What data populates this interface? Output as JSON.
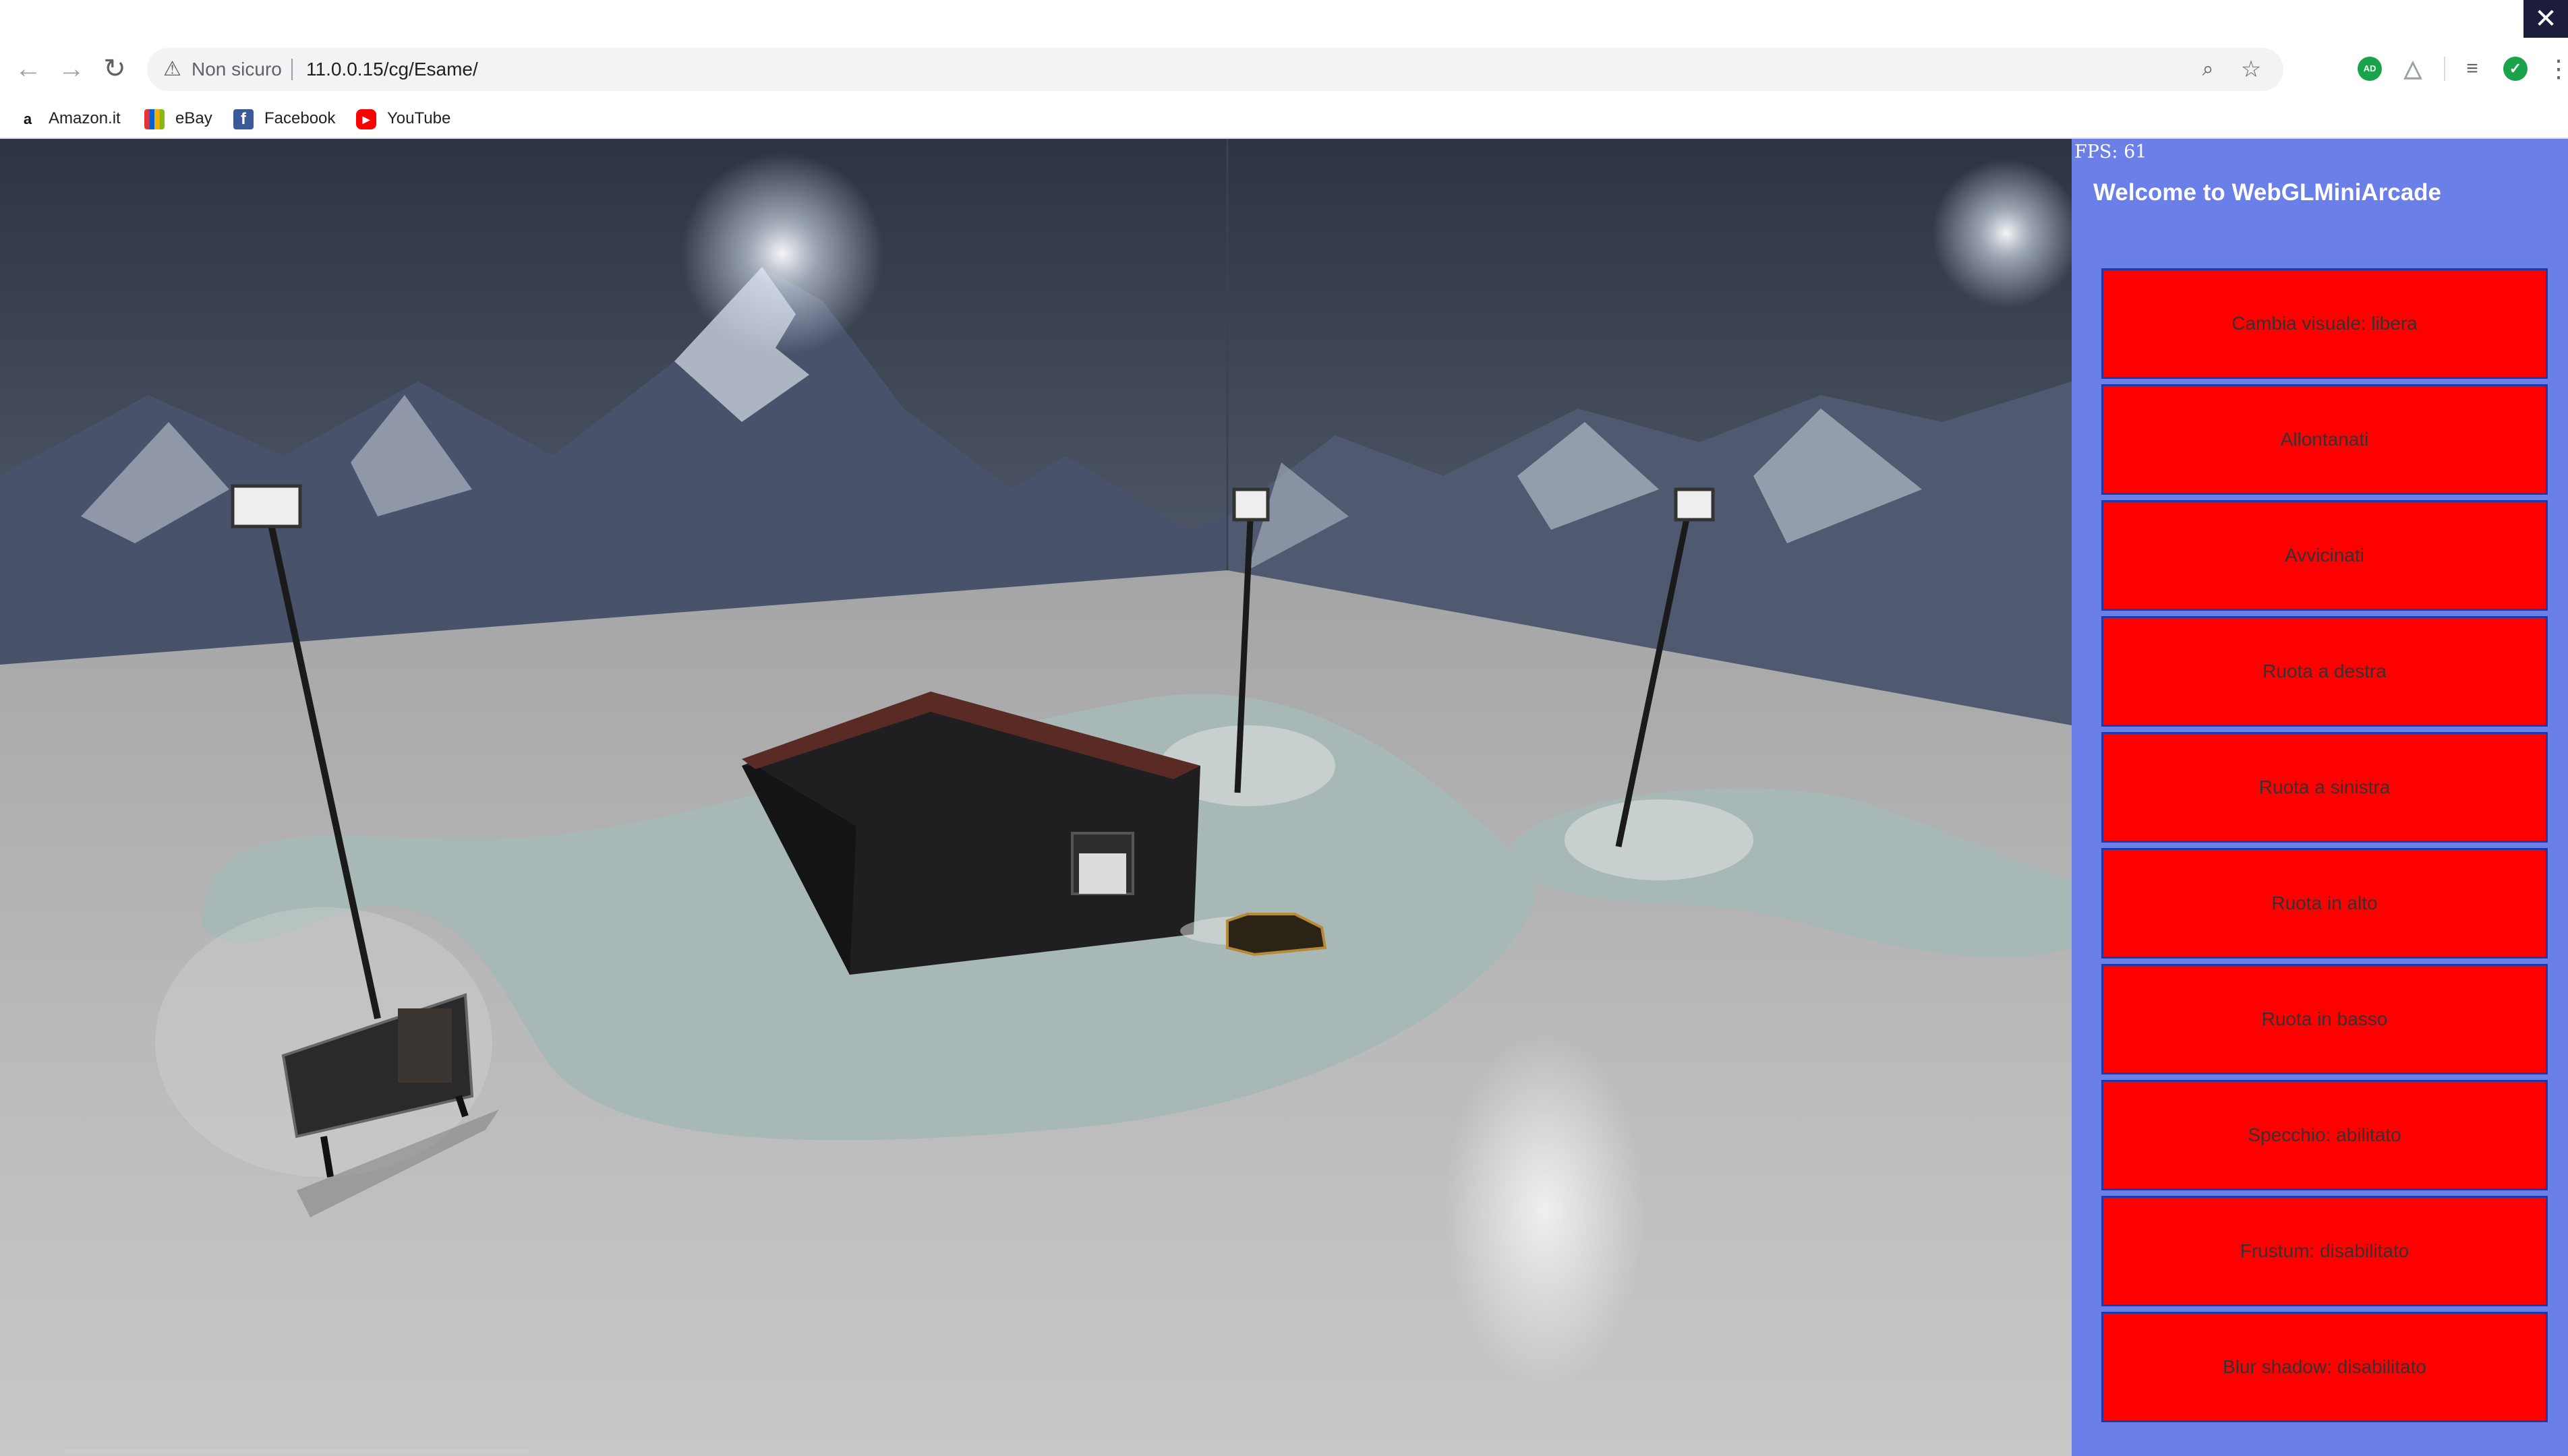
{
  "browser": {
    "security_label": "Non sicuro",
    "url": "11.0.0.15/cg/Esame/",
    "extension_badge": "AD"
  },
  "bookmarks": [
    {
      "label": "Amazon.it",
      "icon": "amazon-icon"
    },
    {
      "label": "eBay",
      "icon": "ebay-icon"
    },
    {
      "label": "Facebook",
      "icon": "facebook-icon"
    },
    {
      "label": "YouTube",
      "icon": "youtube-icon"
    }
  ],
  "panel": {
    "fps": "FPS: 61",
    "welcome": "Welcome to WebGLMiniArcade",
    "buttons": [
      "Cambia visuale: libera",
      "Allontanati",
      "Avvicinati",
      "Ruota a destra",
      "Ruota a sinistra",
      "Ruota in alto",
      "Ruota in basso",
      "Specchio: abilitato",
      "Frustum: disabilitato",
      "Blur shadow: disabilitato"
    ],
    "button_color": "#ff0000",
    "background_color": "#6b7fe8"
  },
  "scene": {
    "sky_color": "#3b4458",
    "snow_color": "#c9c9c9",
    "ice_color": "#a4b8b6"
  }
}
